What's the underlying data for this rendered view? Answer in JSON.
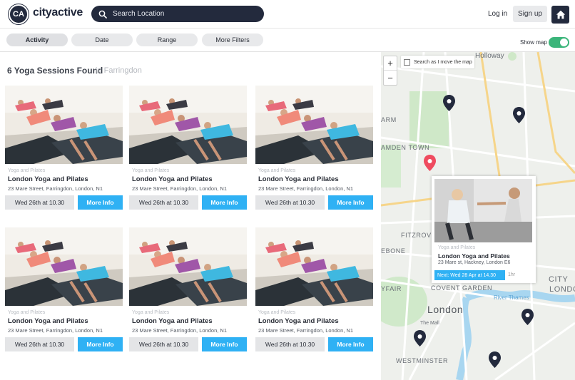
{
  "header": {
    "logo_badge": "CA",
    "logo_text": "cityactive",
    "search_placeholder": "Search Location",
    "login_label": "Log in",
    "signup_label": "Sign up"
  },
  "filters": {
    "pills": [
      "Activity",
      "Date",
      "Range",
      "More Filters"
    ],
    "active": "Activity",
    "show_map_label": "Show map",
    "show_map_on": true
  },
  "results": {
    "title": "6 Yoga Sessions Found",
    "location": "in Farringdon",
    "cards": [
      {
        "category": "Yoga and Pilates",
        "name": "London Yoga and Pilates",
        "address": "23 Mare Street, Farringdon, London, N1",
        "date": "Wed 26th at 10.30",
        "button": "More Info"
      },
      {
        "category": "Yoga and Pilates",
        "name": "London Yoga and Pilates",
        "address": "23 Mare Street, Farringdon, London, N1",
        "date": "Wed 26th at 10.30",
        "button": "More Info"
      },
      {
        "category": "Yoga and Pilates",
        "name": "London Yoga and Pilates",
        "address": "23 Mare Street, Farringdon, London, N1",
        "date": "Wed 26th at 10.30",
        "button": "More Info"
      },
      {
        "category": "Yoga and Pilates",
        "name": "London Yoga and Pilates",
        "address": "23 Mare Street, Farringdon, London, N1",
        "date": "Wed 26th at 10.30",
        "button": "More Info"
      },
      {
        "category": "Yoga and Pilates",
        "name": "London Yoga and Pilates",
        "address": "23 Mare Street, Farringdon, London, N1",
        "date": "Wed 26th at 10.30",
        "button": "More Info"
      },
      {
        "category": "Yoga and Pilates",
        "name": "London Yoga and Pilates",
        "address": "23 Mare Street, Farringdon, London, N1",
        "date": "Wed 26th at 10.30",
        "button": "More Info"
      }
    ]
  },
  "map": {
    "zoom_in": "+",
    "zoom_out": "−",
    "search_as_move_label": "Search as I move the map",
    "labels": {
      "holloway": "Holloway",
      "camden": "AMDEN TOWN",
      "arm": "ARM",
      "fitzrovia": "FITZROV",
      "ebone": "EBONE",
      "yfair": "YFAIR",
      "covent": "COVENT GARDEN",
      "london": "London",
      "city": "CITY",
      "city2": "LONDO",
      "westminster": "WESTMINSTER",
      "thames": "River Thames",
      "mall": "The Mall"
    },
    "popup": {
      "category": "Yoga and Pilates",
      "name": "London Yoga and Pilates",
      "address": "23 Mare st, Hackney, London E6",
      "next": "Next: Wed 28 Apr at 14.30",
      "duration": "1hr"
    }
  },
  "colors": {
    "brand_dark": "#232a3d",
    "accent_blue": "#2fb1f4",
    "toggle_green": "#3bb57a",
    "pin_dark": "#232a3d",
    "pin_red": "#ef4b5f"
  }
}
